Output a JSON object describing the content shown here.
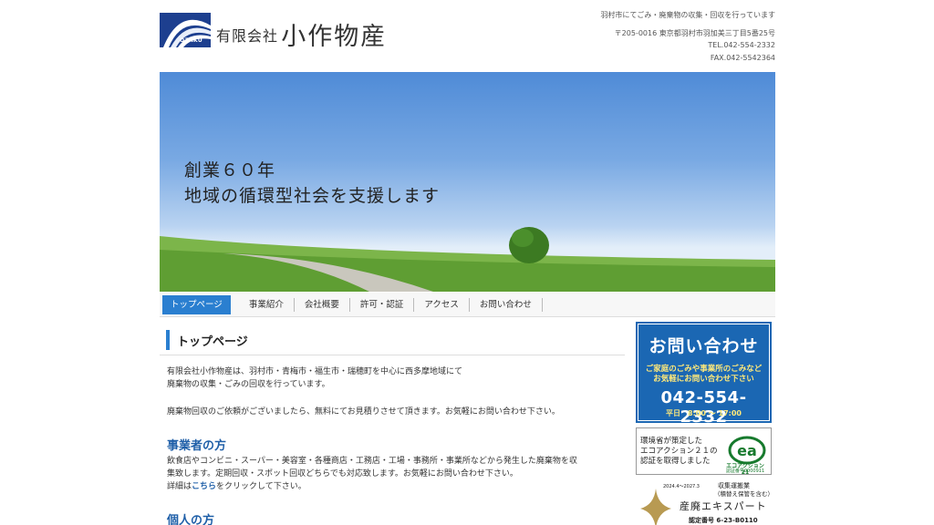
{
  "header": {
    "logo_text": "OZAKU",
    "company_prefix": "有限会社",
    "company_name": "小作物産",
    "tagline": "羽村市にてごみ・廃棄物の収集・回収を行っています",
    "address": "〒205-0016 東京都羽村市羽加美三丁目5番25号",
    "tel": "TEL.042-554-2332",
    "fax": "FAX.042-5542364"
  },
  "hero": {
    "line1": "創業６０年",
    "line2": "地域の循環型社会を支援します"
  },
  "nav": {
    "items": [
      "トップページ",
      "事業紹介",
      "会社概要",
      "許可・認証",
      "アクセス",
      "お問い合わせ"
    ],
    "active_index": 0
  },
  "main": {
    "page_title": "トップページ",
    "intro_line1": "有限会社小作物産は、羽村市・青梅市・福生市・瑞穂町を中心に西多摩地域にて",
    "intro_line2": "廃棄物の収集・ごみの回収を行っています。",
    "estimate": "廃棄物回収のご依頼がございましたら、無料にてお見積りさせて頂きます。お気軽にお問い合わせ下さい。",
    "business": {
      "heading": "事業者の方",
      "line1": "飲食店やコンビニ・スーパー・美容室・各種商店・工務店・工場・事務所・事業所などから発生した廃棄物を収",
      "line2": "集致します。定期回収・スポット回収どちらでも対応致します。お気軽にお問い合わせ下さい。",
      "detail_prefix": "詳細は",
      "detail_link": "こちら",
      "detail_suffix": "をクリックして下さい。"
    },
    "personal": {
      "heading": "個人の方"
    }
  },
  "sidebar": {
    "contact": {
      "title": "お問い合わせ",
      "desc_line1": "ご家庭のごみや事業所のごみなど",
      "desc_line2": "お気軽にお問い合わせ下さい",
      "phone": "042-554-2332",
      "hours": "平日　8:00 ～ 17:00"
    },
    "eco": {
      "line1": "環境省が策定した",
      "line2": "エコアクション２１の",
      "line3": "認証を取得しました",
      "logo_caption": "エコアクション21",
      "reg_no": "認証番号0000911"
    },
    "expert": {
      "period": "2024.4～2027.3",
      "category_line1": "収集運搬業",
      "category_line2": "（積替え保管を含む）",
      "name": "産廃エキスパート",
      "cert_no": "認定番号 6-23-B0110"
    }
  },
  "colors": {
    "accent": "#2a7fd0",
    "contact_bg": "#1b67b3",
    "contact_highlight": "#ffe97a",
    "heading": "#1f5fa8",
    "logo_bg": "#1d3f8f",
    "eco_green": "#177a2d"
  }
}
